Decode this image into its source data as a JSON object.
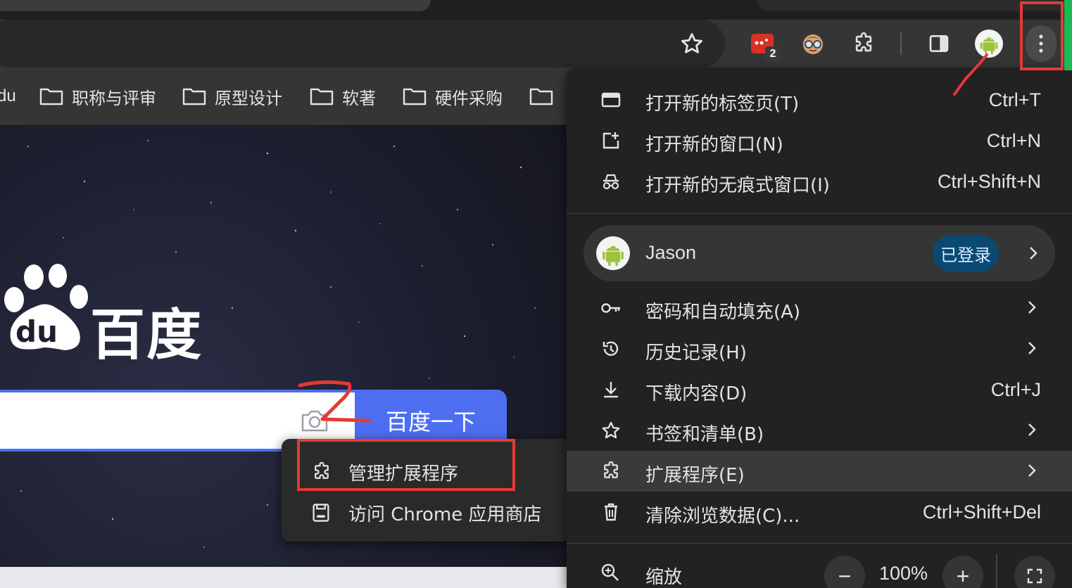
{
  "bookmarks": {
    "partial_first": "du",
    "items": [
      {
        "label": "职称与评审"
      },
      {
        "label": "原型设计"
      },
      {
        "label": "软著"
      },
      {
        "label": "硬件采购"
      }
    ]
  },
  "toolbar": {
    "extension_badge_count": "2"
  },
  "page": {
    "logo_text": "百度",
    "search_button": "百度一下"
  },
  "submenu": {
    "manage_extensions": "管理扩展程序",
    "visit_store": "访问 Chrome 应用商店"
  },
  "menu": {
    "new_tab": {
      "label": "打开新的标签页(T)",
      "shortcut": "Ctrl+T"
    },
    "new_window": {
      "label": "打开新的窗口(N)",
      "shortcut": "Ctrl+N"
    },
    "new_incognito": {
      "label": "打开新的无痕式窗口(I)",
      "shortcut": "Ctrl+Shift+N"
    },
    "profile": {
      "name": "Jason",
      "status": "已登录"
    },
    "passwords": {
      "label": "密码和自动填充(A)"
    },
    "history": {
      "label": "历史记录(H)"
    },
    "downloads": {
      "label": "下载内容(D)",
      "shortcut": "Ctrl+J"
    },
    "bookmarks": {
      "label": "书签和清单(B)"
    },
    "extensions": {
      "label": "扩展程序(E)"
    },
    "clear_data": {
      "label": "清除浏览数据(C)...",
      "shortcut": "Ctrl+Shift+Del"
    },
    "zoom": {
      "label": "缩放",
      "minus": "−",
      "value": "100%",
      "plus": "+"
    }
  },
  "colors": {
    "accent_blue": "#4e6ef2",
    "annotation_red": "#e53935",
    "signed_in_badge": "#0a4a72"
  }
}
